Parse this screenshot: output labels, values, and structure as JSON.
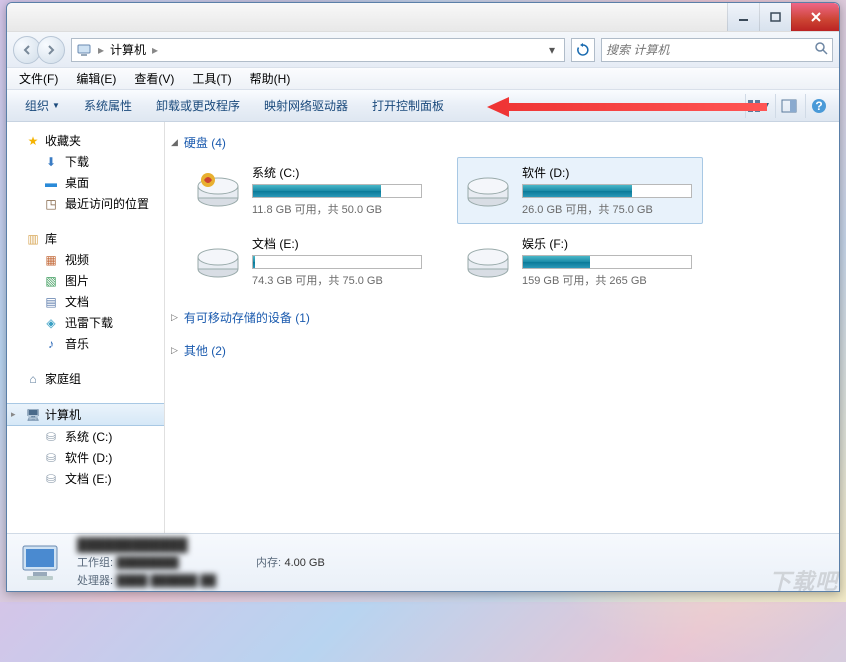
{
  "address": {
    "location": "计算机"
  },
  "search": {
    "placeholder": "搜索 计算机"
  },
  "menu": {
    "file": "文件(F)",
    "edit": "编辑(E)",
    "view": "查看(V)",
    "tools": "工具(T)",
    "help": "帮助(H)"
  },
  "toolbar": {
    "organize": "组织",
    "properties": "系统属性",
    "uninstall": "卸载或更改程序",
    "map_drive": "映射网络驱动器",
    "control_panel": "打开控制面板"
  },
  "sidebar": {
    "favorites": {
      "label": "收藏夹",
      "items": [
        {
          "label": "下载"
        },
        {
          "label": "桌面"
        },
        {
          "label": "最近访问的位置"
        }
      ]
    },
    "libraries": {
      "label": "库",
      "items": [
        {
          "label": "视频"
        },
        {
          "label": "图片"
        },
        {
          "label": "文档"
        },
        {
          "label": "迅雷下载"
        },
        {
          "label": "音乐"
        }
      ]
    },
    "homegroup": {
      "label": "家庭组"
    },
    "computer": {
      "label": "计算机",
      "items": [
        {
          "label": "系统 (C:)"
        },
        {
          "label": "软件 (D:)"
        },
        {
          "label": "文档 (E:)"
        }
      ]
    }
  },
  "sections": {
    "hdd": {
      "label": "硬盘 (4)"
    },
    "removable": {
      "label": "有可移动存储的设备 (1)"
    },
    "other": {
      "label": "其他 (2)"
    }
  },
  "drives": [
    {
      "name": "系统 (C:)",
      "free": "11.8 GB",
      "total": "50.0 GB",
      "stat": "11.8 GB 可用，共 50.0 GB",
      "pct": 76,
      "selected": false
    },
    {
      "name": "软件 (D:)",
      "free": "26.0 GB",
      "total": "75.0 GB",
      "stat": "26.0 GB 可用，共 75.0 GB",
      "pct": 65,
      "selected": true
    },
    {
      "name": "文档 (E:)",
      "free": "74.3 GB",
      "total": "75.0 GB",
      "stat": "74.3 GB 可用，共 75.0 GB",
      "pct": 1,
      "selected": false
    },
    {
      "name": "娱乐 (F:)",
      "free": "159 GB",
      "total": "265 GB",
      "stat": "159 GB 可用，共 265 GB",
      "pct": 40,
      "selected": false
    }
  ],
  "details": {
    "workgroup_label": "工作组:",
    "memory_label": "内存:",
    "memory_value": "4.00 GB",
    "cpu_label": "处理器:"
  }
}
